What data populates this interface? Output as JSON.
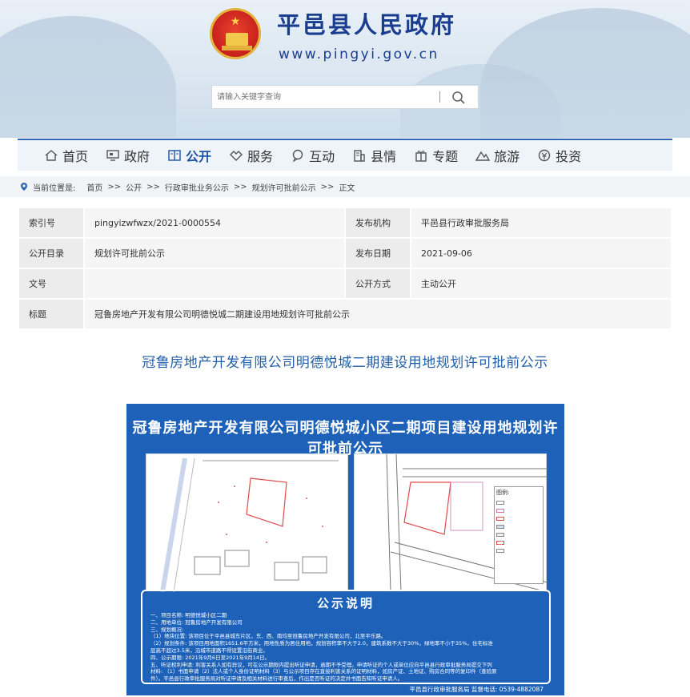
{
  "header": {
    "site_title": "平邑县人民政府",
    "site_url": "www.pingyi.gov.cn",
    "search_placeholder": "请输入关键字查询"
  },
  "nav": {
    "items": [
      {
        "label": "首页",
        "icon": "home-icon"
      },
      {
        "label": "政府",
        "icon": "monitor-icon"
      },
      {
        "label": "公开",
        "icon": "book-icon",
        "active": true
      },
      {
        "label": "服务",
        "icon": "handshake-icon"
      },
      {
        "label": "互动",
        "icon": "chat-icon"
      },
      {
        "label": "县情",
        "icon": "building-icon"
      },
      {
        "label": "专题",
        "icon": "gift-icon"
      },
      {
        "label": "旅游",
        "icon": "mountain-icon"
      },
      {
        "label": "投资",
        "icon": "money-icon"
      }
    ]
  },
  "breadcrumb": {
    "prefix": "当前位置是:",
    "items": [
      "首页",
      "公开",
      "行政审批业务公示",
      "规划许可批前公示",
      "正文"
    ],
    "sep": ">>"
  },
  "info": {
    "index_label": "索引号",
    "index_value": "pingyizwfwzx/2021-0000554",
    "publisher_label": "发布机构",
    "publisher_value": "平邑县行政审批服务局",
    "catalog_label": "公开目录",
    "catalog_value": "规划许可批前公示",
    "date_label": "发布日期",
    "date_value": "2021-09-06",
    "docno_label": "文号",
    "docno_value": "",
    "mode_label": "公开方式",
    "mode_value": "主动公开",
    "title_label": "标题",
    "title_value": "冠鲁房地产开发有限公司明德悦城二期建设用地规划许可批前公示"
  },
  "article": {
    "title": "冠鲁房地产开发有限公司明德悦城二期建设用地规划许可批前公示"
  },
  "notice": {
    "title": "冠鲁房地产开发有限公司明德悦城小区二期项目建设用地规划许可批前公示",
    "legend_title": "图例:",
    "explain_title": "公示说明",
    "lines": [
      "一、项目名称: 明德悦城小区二期",
      "二、用地单位: 冠鲁房地产开发有限公司",
      "三、规划概况:",
      "（1）地块位置: 该项目位于平邑县城东片区，东、西、南均至冠鲁房地产开发有限公司，北至平乐路。",
      "（2）规划条件: 该项目用地面积1651.6平方米，用地性质为居住用地，规划容积率不大于2.0，建筑系数不大于30%，绿地率不小于35%，住宅标准",
      "层高不超过3.5米，沿城市道路不得设置沿街商业。",
      "四、公示期限: 2021年9月6日至2021年9月14日。",
      "五、听证权利申请: 利害关系人如有异议，可在公示期限内提出听证申请，逾期不予受理。申请听证的个人或单位应向平邑县行政审批服务局提交下列",
      "材料: （1）书面申请（2）法人或个人身份证明材料（3）与公示项目存在直接利害关系的证明材料，如房产证、土地证、购房合同等的复印件（查验原",
      "件）。平邑县行政审批服务局对听证申请及相关材料进行审查后，作出是否听证的决定并书面告知听证申请人。"
    ],
    "footer": "平邑县行政审批服务局    监督电话: 0539-4882087"
  },
  "colors": {
    "brand_blue": "#1a3d8f",
    "nav_active": "#1d52a6",
    "notice_bg": "#1d62b8",
    "title_blue": "#2460a8"
  }
}
